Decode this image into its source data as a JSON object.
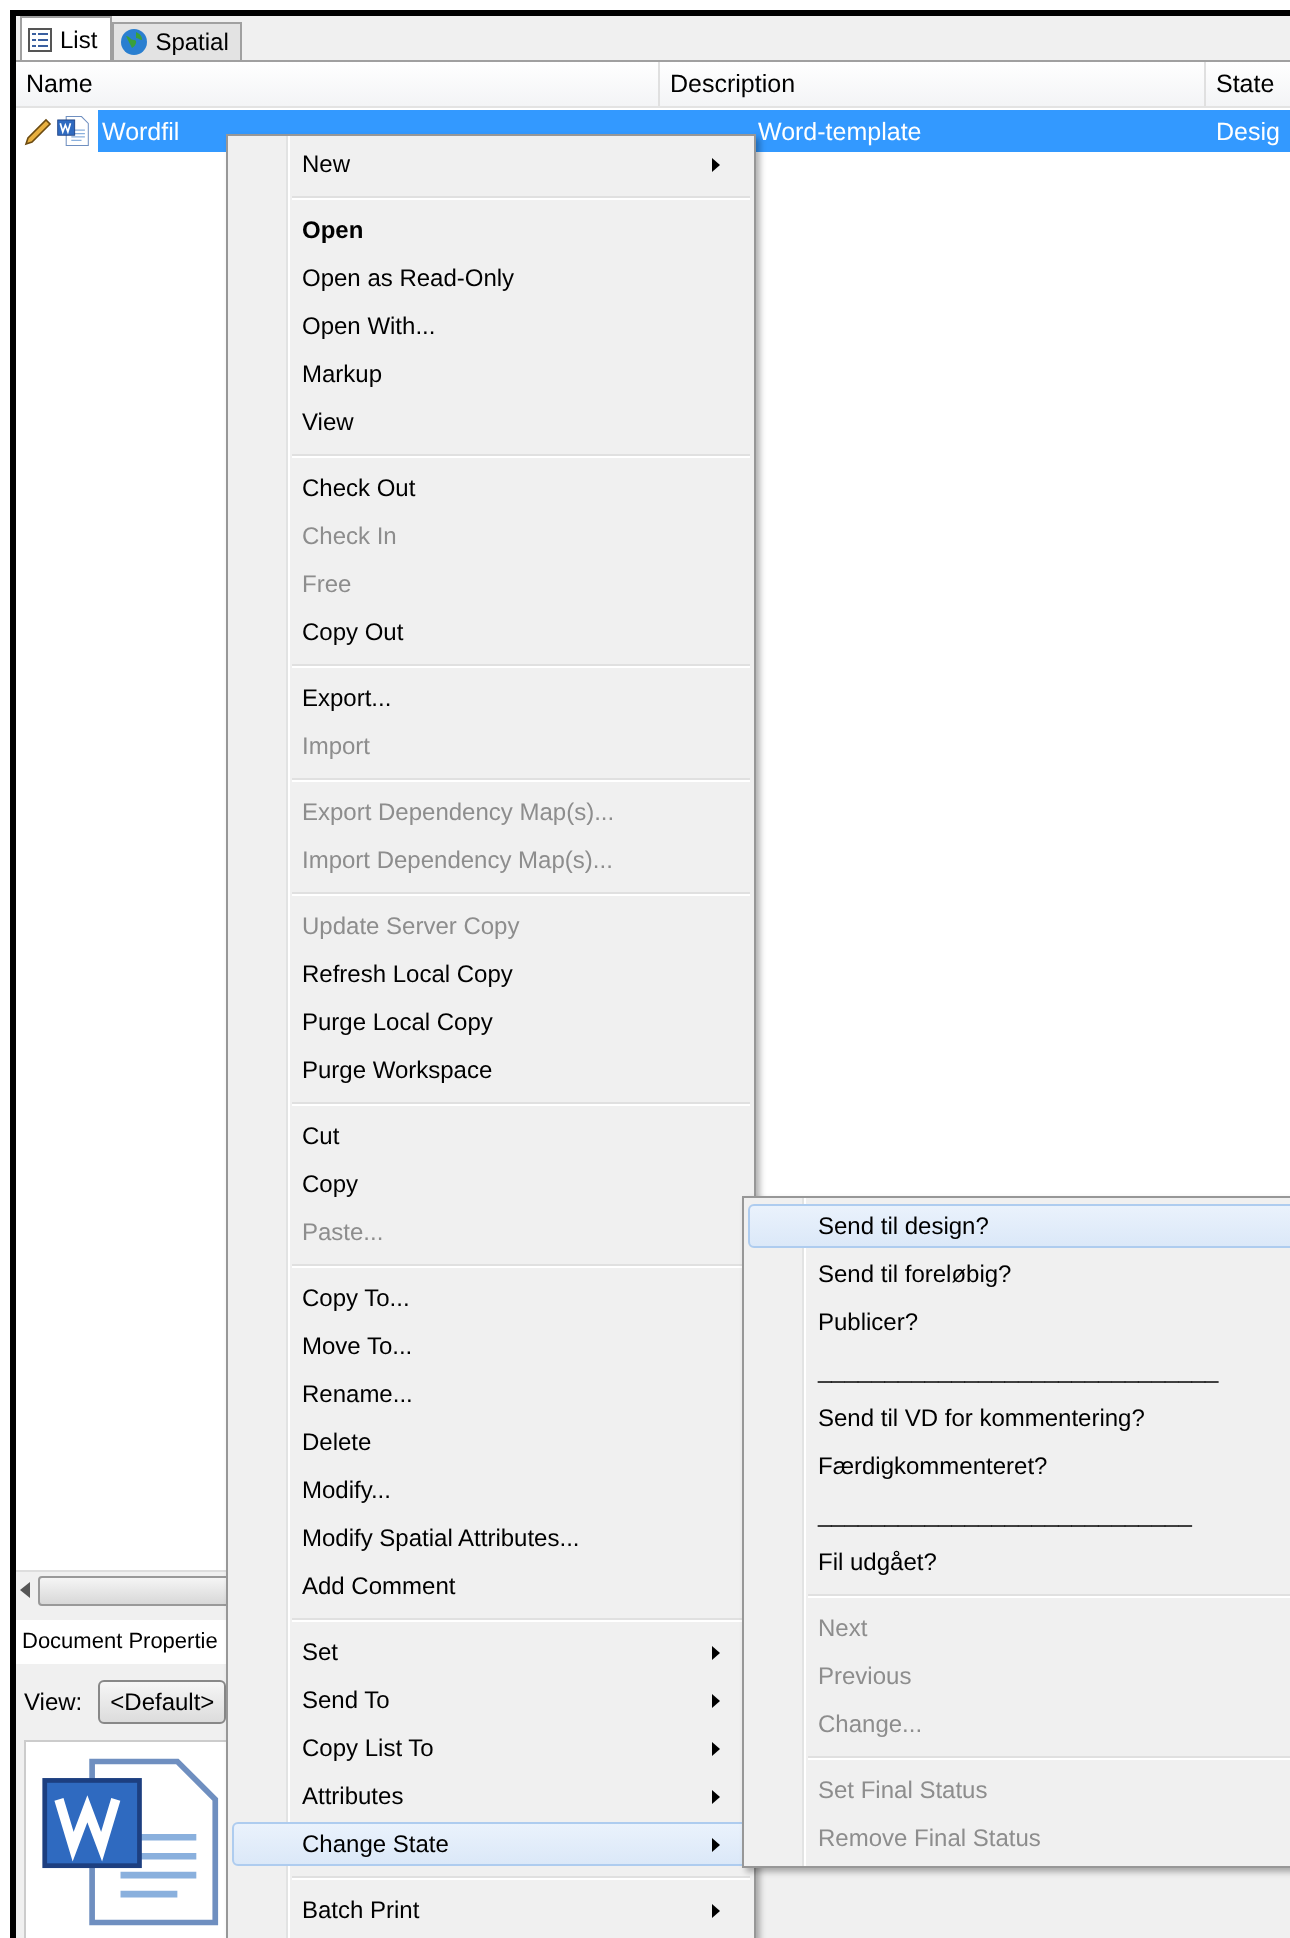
{
  "tabs": [
    {
      "label": "List",
      "selected": true
    },
    {
      "label": "Spatial",
      "selected": false
    }
  ],
  "columns": [
    "Name",
    "Description",
    "State"
  ],
  "rows": [
    {
      "name": "Wordfil",
      "description": "Word-template",
      "state": "Desig",
      "selected": true
    }
  ],
  "properties": {
    "title": "Document Propertie",
    "view_label": "View:",
    "view_value": "<Default>"
  },
  "context_menu": [
    [
      {
        "label": "New",
        "bold": false,
        "disabled": false,
        "submenu": true,
        "selected": false
      }
    ],
    [
      {
        "label": "Open",
        "bold": true,
        "disabled": false,
        "submenu": false,
        "selected": false
      },
      {
        "label": "Open as Read-Only",
        "bold": false,
        "disabled": false,
        "submenu": false,
        "selected": false
      },
      {
        "label": "Open With...",
        "bold": false,
        "disabled": false,
        "submenu": false,
        "selected": false
      },
      {
        "label": "Markup",
        "bold": false,
        "disabled": false,
        "submenu": false,
        "selected": false
      },
      {
        "label": "View",
        "bold": false,
        "disabled": false,
        "submenu": false,
        "selected": false
      }
    ],
    [
      {
        "label": "Check Out",
        "bold": false,
        "disabled": false,
        "submenu": false,
        "selected": false
      },
      {
        "label": "Check In",
        "bold": false,
        "disabled": true,
        "submenu": false,
        "selected": false
      },
      {
        "label": "Free",
        "bold": false,
        "disabled": true,
        "submenu": false,
        "selected": false
      },
      {
        "label": "Copy Out",
        "bold": false,
        "disabled": false,
        "submenu": false,
        "selected": false
      }
    ],
    [
      {
        "label": "Export...",
        "bold": false,
        "disabled": false,
        "submenu": false,
        "selected": false
      },
      {
        "label": "Import",
        "bold": false,
        "disabled": true,
        "submenu": false,
        "selected": false
      }
    ],
    [
      {
        "label": "Export Dependency Map(s)...",
        "bold": false,
        "disabled": true,
        "submenu": false,
        "selected": false
      },
      {
        "label": "Import Dependency Map(s)...",
        "bold": false,
        "disabled": true,
        "submenu": false,
        "selected": false
      }
    ],
    [
      {
        "label": "Update Server Copy",
        "bold": false,
        "disabled": true,
        "submenu": false,
        "selected": false
      },
      {
        "label": "Refresh Local Copy",
        "bold": false,
        "disabled": false,
        "submenu": false,
        "selected": false
      },
      {
        "label": "Purge Local Copy",
        "bold": false,
        "disabled": false,
        "submenu": false,
        "selected": false
      },
      {
        "label": "Purge Workspace",
        "bold": false,
        "disabled": false,
        "submenu": false,
        "selected": false
      }
    ],
    [
      {
        "label": "Cut",
        "bold": false,
        "disabled": false,
        "submenu": false,
        "selected": false
      },
      {
        "label": "Copy",
        "bold": false,
        "disabled": false,
        "submenu": false,
        "selected": false
      },
      {
        "label": "Paste...",
        "bold": false,
        "disabled": true,
        "submenu": false,
        "selected": false
      }
    ],
    [
      {
        "label": "Copy To...",
        "bold": false,
        "disabled": false,
        "submenu": false,
        "selected": false
      },
      {
        "label": "Move To...",
        "bold": false,
        "disabled": false,
        "submenu": false,
        "selected": false
      },
      {
        "label": "Rename...",
        "bold": false,
        "disabled": false,
        "submenu": false,
        "selected": false
      },
      {
        "label": "Delete",
        "bold": false,
        "disabled": false,
        "submenu": false,
        "selected": false
      },
      {
        "label": "Modify...",
        "bold": false,
        "disabled": false,
        "submenu": false,
        "selected": false
      },
      {
        "label": "Modify Spatial Attributes...",
        "bold": false,
        "disabled": false,
        "submenu": false,
        "selected": false
      },
      {
        "label": "Add Comment",
        "bold": false,
        "disabled": false,
        "submenu": false,
        "selected": false
      }
    ],
    [
      {
        "label": "Set",
        "bold": false,
        "disabled": false,
        "submenu": true,
        "selected": false
      },
      {
        "label": "Send To",
        "bold": false,
        "disabled": false,
        "submenu": true,
        "selected": false
      },
      {
        "label": "Copy List To",
        "bold": false,
        "disabled": false,
        "submenu": true,
        "selected": false
      },
      {
        "label": "Attributes",
        "bold": false,
        "disabled": false,
        "submenu": true,
        "selected": false
      },
      {
        "label": "Change State",
        "bold": false,
        "disabled": false,
        "submenu": true,
        "selected": true
      }
    ],
    [
      {
        "label": "Batch Print",
        "bold": false,
        "disabled": false,
        "submenu": true,
        "selected": false
      }
    ]
  ],
  "state_submenu": [
    [
      {
        "label": "Send til design?",
        "disabled": false,
        "selected": true
      },
      {
        "label": "Send til foreløbig?",
        "disabled": false,
        "selected": false
      },
      {
        "label": "Publicer?",
        "disabled": false,
        "selected": false
      },
      {
        "label": "______________________________",
        "disabled": false,
        "selected": false
      },
      {
        "label": "Send til VD for kommentering?",
        "disabled": false,
        "selected": false
      },
      {
        "label": "Færdigkommenteret?",
        "disabled": false,
        "selected": false
      },
      {
        "label": "____________________________",
        "disabled": false,
        "selected": false
      },
      {
        "label": "Fil udgået?",
        "disabled": false,
        "selected": false
      }
    ],
    [
      {
        "label": "Next",
        "disabled": true,
        "selected": false
      },
      {
        "label": "Previous",
        "disabled": true,
        "selected": false
      },
      {
        "label": "Change...",
        "disabled": true,
        "selected": false
      }
    ],
    [
      {
        "label": "Set Final Status",
        "disabled": true,
        "selected": false
      },
      {
        "label": "Remove Final Status",
        "disabled": true,
        "selected": false
      }
    ]
  ]
}
